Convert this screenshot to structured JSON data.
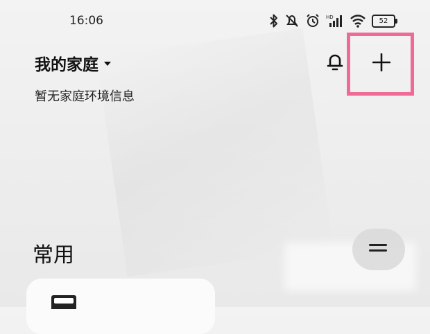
{
  "status_bar": {
    "time": "16:06",
    "battery": "52",
    "icons": [
      "bluetooth-icon",
      "mute-icon",
      "alarm-icon",
      "hd-signal-icon",
      "wifi-icon",
      "battery-icon"
    ]
  },
  "header": {
    "home_title": "我的家庭",
    "subtitle": "暂无家庭环境信息",
    "bell_icon": "bell-icon",
    "add_icon": "plus-icon",
    "highlight_color": "#ef6b95"
  },
  "section": {
    "title": "常用",
    "menu_icon": "menu-icon"
  }
}
